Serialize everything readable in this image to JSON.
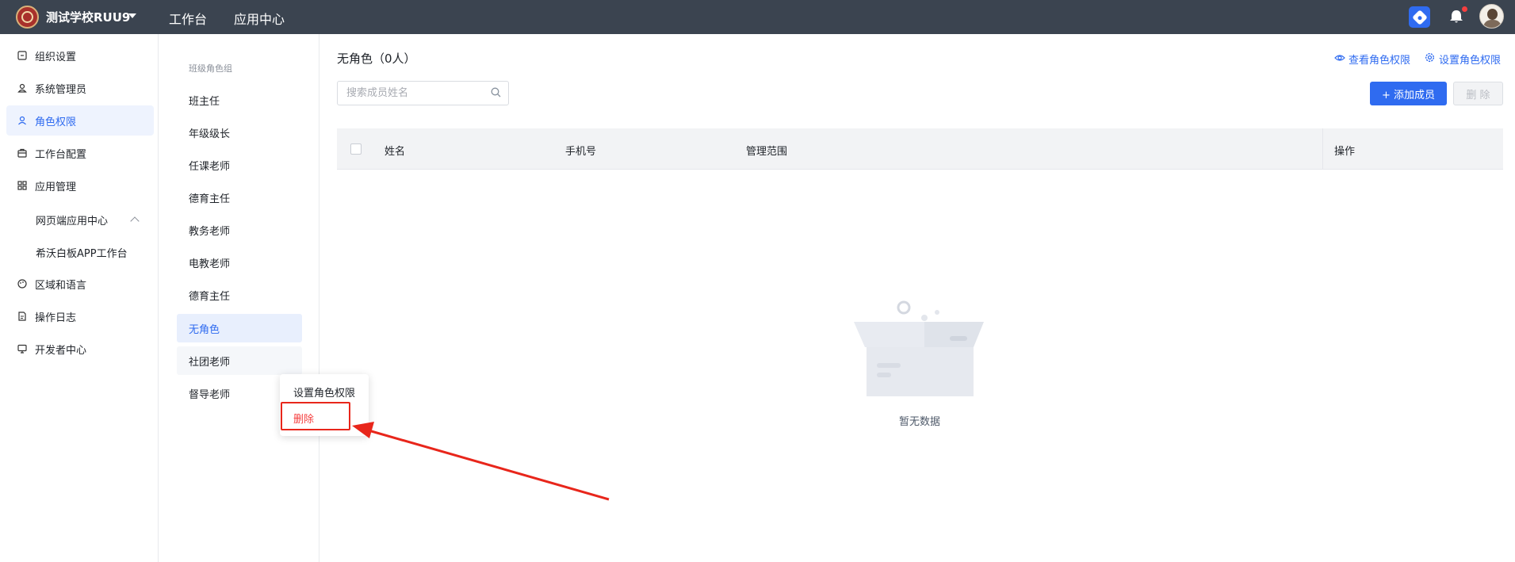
{
  "topbar": {
    "school_name": "测试学校RUU9",
    "nav": [
      "工作台",
      "应用中心"
    ],
    "icons": {
      "app": "hexagon-app-icon",
      "bell": "bell-icon",
      "avatar": "user-avatar"
    },
    "accent": "#2f6bf0",
    "bg": "#3b4450"
  },
  "sidebar": {
    "items": [
      {
        "label": "组织设置",
        "icon": "org-settings-icon"
      },
      {
        "label": "系统管理员",
        "icon": "admin-user-icon"
      },
      {
        "label": "角色权限",
        "icon": "role-user-icon",
        "active": true
      },
      {
        "label": "工作台配置",
        "icon": "briefcase-icon"
      },
      {
        "label": "应用管理",
        "icon": "grid-apps-icon",
        "expanded": true
      },
      {
        "label": "区域和语言",
        "icon": "globe-palette-icon"
      },
      {
        "label": "操作日志",
        "icon": "log-file-icon"
      },
      {
        "label": "开发者中心",
        "icon": "monitor-dev-icon"
      }
    ],
    "sub_items": [
      "网页端应用中心",
      "希沃白板APP工作台"
    ]
  },
  "roles": {
    "group_title": "班级角色组",
    "items": [
      "班主任",
      "年级级长",
      "任课老师",
      "德育主任",
      "教务老师",
      "电教老师",
      "德育主任",
      "无角色",
      "社团老师",
      "督导老师"
    ],
    "active": "无角色"
  },
  "context_menu": {
    "set_permission": "设置角色权限",
    "delete": "删除"
  },
  "main": {
    "title": "无角色（0人）",
    "view_permission": "查看角色权限",
    "set_permission": "设置角色权限",
    "search_placeholder": "搜索成员姓名",
    "add_member": "+ 添加成员",
    "delete": "删 除",
    "columns": [
      "姓名",
      "手机号",
      "管理范围",
      "操作"
    ],
    "empty_text": "暂无数据"
  },
  "annotation_color": "#e8261b"
}
